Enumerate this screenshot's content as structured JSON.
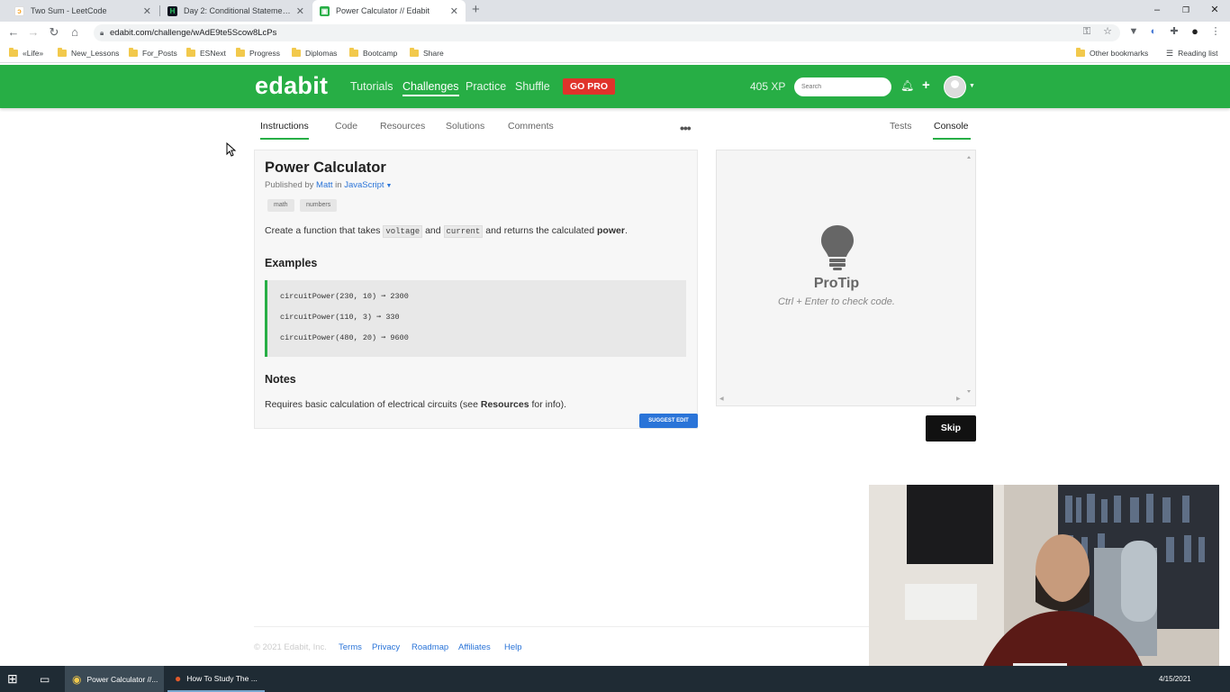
{
  "browser": {
    "tabs": [
      {
        "title": "Two Sum - LeetCode",
        "active": false
      },
      {
        "title": "Day 2: Conditional Statements: If",
        "active": false
      },
      {
        "title": "Power Calculator // Edabit",
        "active": true
      }
    ],
    "new_tab_icon": "+",
    "url": "edabit.com/challenge/wAdE9te5Scow8LcPs",
    "bookmarks": [
      "«Life»",
      "New_Lessons",
      "For_Posts",
      "ESNext",
      "Progress",
      "Diplomas",
      "Bootcamp",
      "Share"
    ],
    "other_bookmarks": "Other bookmarks",
    "reading_list": "Reading list"
  },
  "site": {
    "logo": "edabit",
    "nav": [
      "Tutorials",
      "Challenges",
      "Practice",
      "Shuffle"
    ],
    "go_pro": "GO PRO",
    "xp": "405 XP",
    "search_placeholder": "Search"
  },
  "page_tabs": {
    "left": [
      "Instructions",
      "Code",
      "Resources",
      "Solutions",
      "Comments"
    ],
    "right": [
      "Tests",
      "Console"
    ],
    "more": "•••"
  },
  "challenge": {
    "title": "Power Calculator",
    "published_by": "Published by",
    "author": "Matt",
    "in": "in",
    "language": "JavaScript",
    "tags": [
      "math",
      "numbers"
    ],
    "desc_1": "Create a function that takes",
    "code_1": "voltage",
    "desc_and": "and",
    "code_2": "current",
    "desc_2": "and returns the calculated",
    "desc_bold": "power",
    "desc_end": ".",
    "examples_heading": "Examples",
    "examples": [
      "circuitPower(230, 10) ➞ 2300",
      "circuitPower(110, 3) ➞ 330",
      "circuitPower(480, 20) ➞ 9600"
    ],
    "notes_heading": "Notes",
    "notes_1": "Requires basic calculation of electrical circuits (see",
    "notes_bold": "Resources",
    "notes_2": "for info).",
    "suggest_edit": "SUGGEST EDIT"
  },
  "console": {
    "protip_title": "ProTip",
    "protip_text": "Ctrl + Enter to check code.",
    "skip": "Skip"
  },
  "footer": {
    "copyright": "© 2021 Edabit, Inc.",
    "links": [
      "Terms",
      "Privacy",
      "Roadmap",
      "Affiliates",
      "Help"
    ]
  },
  "taskbar": {
    "apps": [
      "Power Calculator //...",
      "How To Study The ..."
    ],
    "date": "4/15/2021"
  },
  "colors": {
    "brand_green": "#27ae45",
    "go_pro_red": "#e0332b",
    "link_blue": "#2a74d8"
  }
}
